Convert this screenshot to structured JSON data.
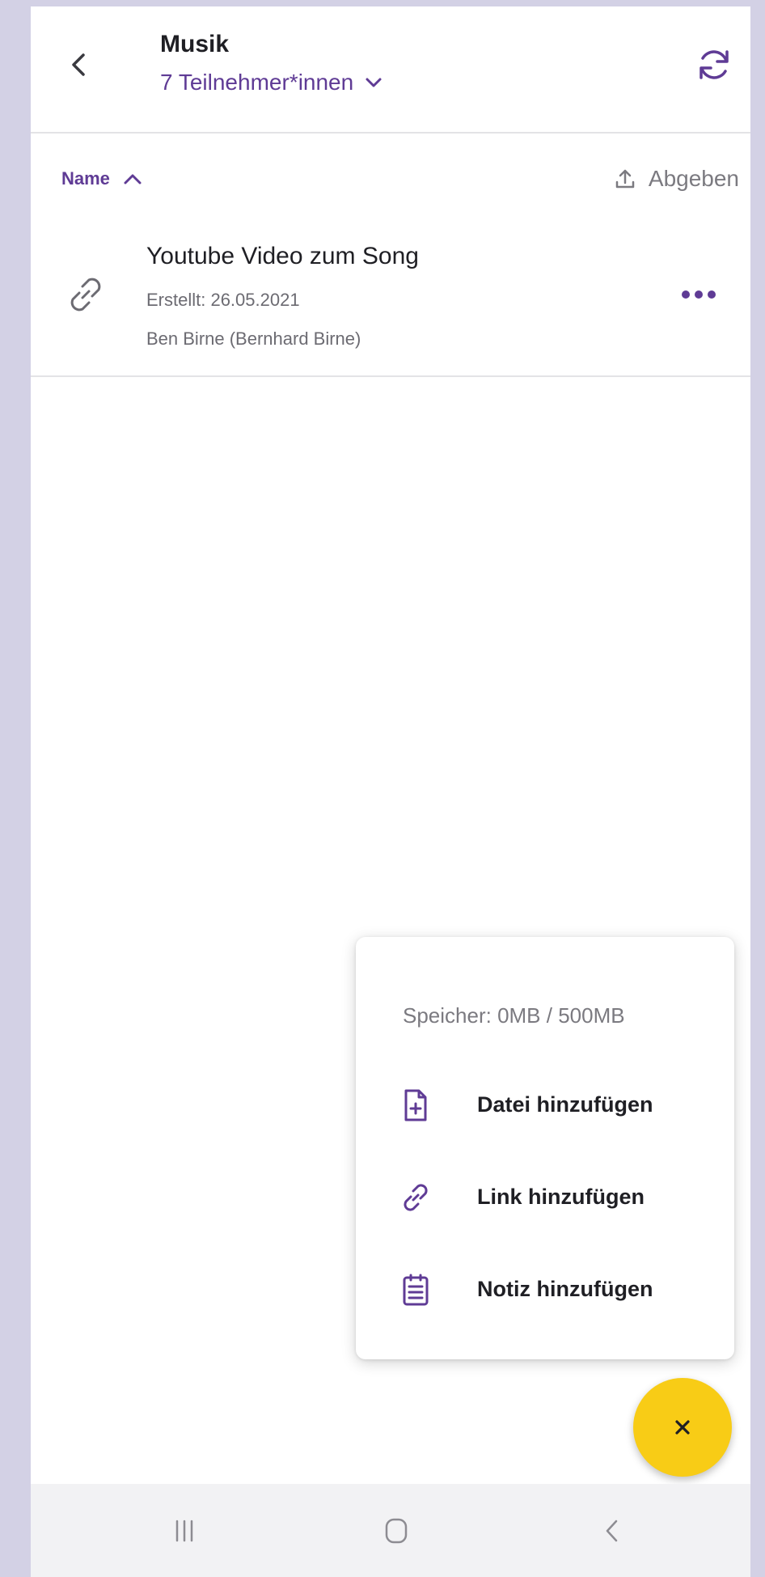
{
  "header": {
    "title": "Musik",
    "participants": "7 Teilnehmer*innen"
  },
  "list_header": {
    "sort_label": "Name",
    "submit_label": "Abgeben"
  },
  "files": [
    {
      "name": "Youtube Video zum Song",
      "created": "Erstellt: 26.05.2021",
      "author": "Ben Birne (Bernhard Birne)",
      "icon": "link-icon"
    }
  ],
  "add_menu": {
    "storage": "Speicher: 0MB / 500MB",
    "items": [
      {
        "label": "Datei hinzufügen",
        "icon": "file-add-icon"
      },
      {
        "label": "Link hinzufügen",
        "icon": "link-icon"
      },
      {
        "label": "Notiz hinzufügen",
        "icon": "note-icon"
      }
    ]
  },
  "fab": {
    "icon": "close-icon"
  },
  "colors": {
    "accent": "#5f3b95",
    "fab": "#f8cc16",
    "background_frame": "#d3d1e5"
  }
}
